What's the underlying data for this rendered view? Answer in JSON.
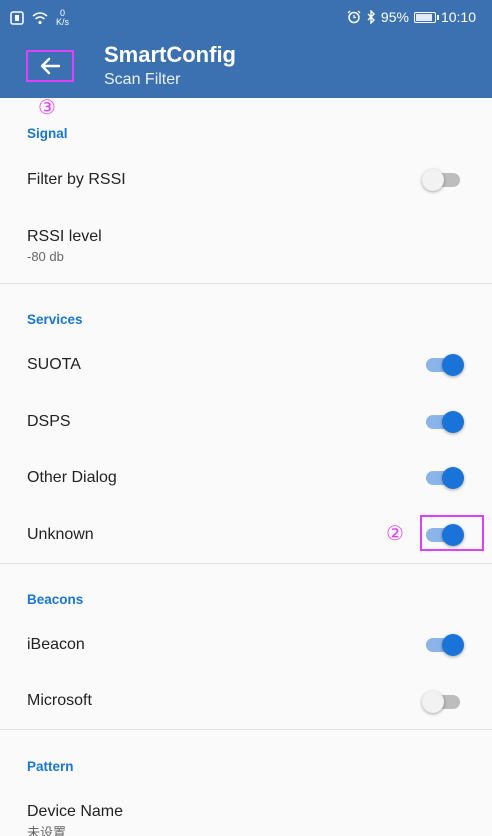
{
  "status_bar": {
    "speed_value": "0",
    "speed_unit": "K/s",
    "battery": "95%",
    "battery_level": 0.95,
    "time": "10:10"
  },
  "app_bar": {
    "title": "SmartConfig",
    "subtitle": "Scan Filter",
    "back_icon": "arrow-left-icon"
  },
  "annotations": {
    "marker_back": "③",
    "marker_switch": "②",
    "accent": "#e040fb"
  },
  "sections": {
    "signal": {
      "header": "Signal",
      "filter_rssi": {
        "label": "Filter by RSSI",
        "on": false
      },
      "rssi_level": {
        "label": "RSSI level",
        "value": "-80 db"
      }
    },
    "services": {
      "header": "Services",
      "suota": {
        "label": "SUOTA",
        "on": true
      },
      "dsps": {
        "label": "DSPS",
        "on": true
      },
      "other_dialog": {
        "label": "Other Dialog",
        "on": true
      },
      "unknown": {
        "label": "Unknown",
        "on": true
      }
    },
    "beacons": {
      "header": "Beacons",
      "ibeacon": {
        "label": "iBeacon",
        "on": true
      },
      "microsoft": {
        "label": "Microsoft",
        "on": false
      }
    },
    "pattern": {
      "header": "Pattern",
      "device_name": {
        "label": "Device Name",
        "value": "未设置"
      }
    }
  },
  "colors": {
    "primary": "#3b71b0",
    "accent_blue": "#1976d2",
    "switch_on": "#1a73d9"
  }
}
